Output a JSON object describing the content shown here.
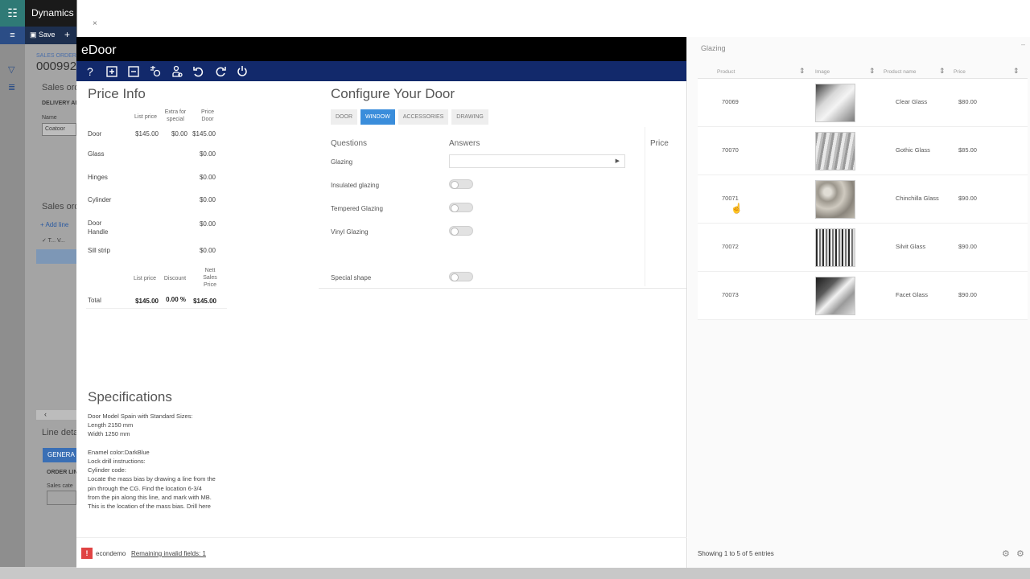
{
  "background_app": {
    "brand": "Dynamics",
    "save_label": "Save",
    "record_caption": "SALES ORDER",
    "record_id": "000992",
    "section_sales": "Sales ord",
    "delivery_caption": "DELIVERY AD",
    "name_caption": "Name",
    "name_value": "Coatoor",
    "section_orders": "Sales ord",
    "add_line": "+ Add line",
    "line_details": "Line deta",
    "generate": "GENERA",
    "order_lines": "ORDER LIN",
    "sales_cate": "Sales cate"
  },
  "edoor": {
    "title": "eDoor",
    "toolbar": [
      "help-icon",
      "add-icon",
      "remove-icon",
      "configure-icon",
      "user-settings-icon",
      "undo-icon",
      "refresh-icon",
      "power-icon"
    ],
    "price_info": {
      "title": "Price Info",
      "headers": {
        "list_price": "List price",
        "extra": "Extra for special",
        "price_door": "Price Door"
      },
      "rows": [
        {
          "label": "Door",
          "list": "$145.00",
          "extra": "$0.00",
          "price": "$145.00"
        },
        {
          "label": "Glass",
          "price": "$0.00"
        },
        {
          "label": "Hinges",
          "price": "$0.00"
        },
        {
          "label": "Cylinder",
          "price": "$0.00"
        },
        {
          "label": "Door Handle",
          "price": "$0.00"
        },
        {
          "label": "Sill strip",
          "price": "$0.00"
        }
      ],
      "total_headers": {
        "list_price": "List price",
        "discount": "Discount",
        "net": "Nett Sales Price"
      },
      "total": {
        "label": "Total",
        "list": "$145.00",
        "discount": "0.00 %",
        "net": "$145.00"
      }
    },
    "configure": {
      "title": "Configure Your Door",
      "tabs": [
        "DOOR",
        "WINDOW",
        "ACCESSORIES",
        "DRAWING"
      ],
      "active_tab": "WINDOW",
      "col_questions": "Questions",
      "col_answers": "Answers",
      "col_price": "Price",
      "questions": [
        "Glazing",
        "Insulated glazing",
        "Tempered Glazing",
        "Vinyl Glazing",
        "Special shape"
      ]
    },
    "specifications": {
      "title": "Specifications",
      "text": "Door Model Spain with Standard Sizes:\nLength 2150 mm\nWidth 1250 mm\n\nEnamel color:DarkBlue\nLock drill instructions:\nCylinder code:\nLocate the mass bias by drawing a line from the\npin through the CG. Find the location 6-3/4\nfrom the pin along this line, and mark with MB.\nThis is the location of the mass bias. Drill here"
    },
    "footer": {
      "user": "econdemo",
      "link": "Remaining invalid fields: 1"
    }
  },
  "glazing": {
    "title": "Glazing",
    "columns": [
      "Product",
      "Image",
      "Product name",
      "Price"
    ],
    "rows": [
      {
        "product": "70069",
        "name": "Clear Glass",
        "price": "$80.00",
        "style": "clear"
      },
      {
        "product": "70070",
        "name": "Gothic Glass",
        "price": "$85.00",
        "style": "gothic"
      },
      {
        "product": "70071",
        "name": "Chinchilla Glass",
        "price": "$90.00",
        "style": "chinchilla"
      },
      {
        "product": "70072",
        "name": "Silvit Glass",
        "price": "$90.00",
        "style": "silvit"
      },
      {
        "product": "70073",
        "name": "Facet Glass",
        "price": "$90.00",
        "style": "facet"
      }
    ],
    "footer": "Showing 1 to 5 of 5 entries"
  }
}
